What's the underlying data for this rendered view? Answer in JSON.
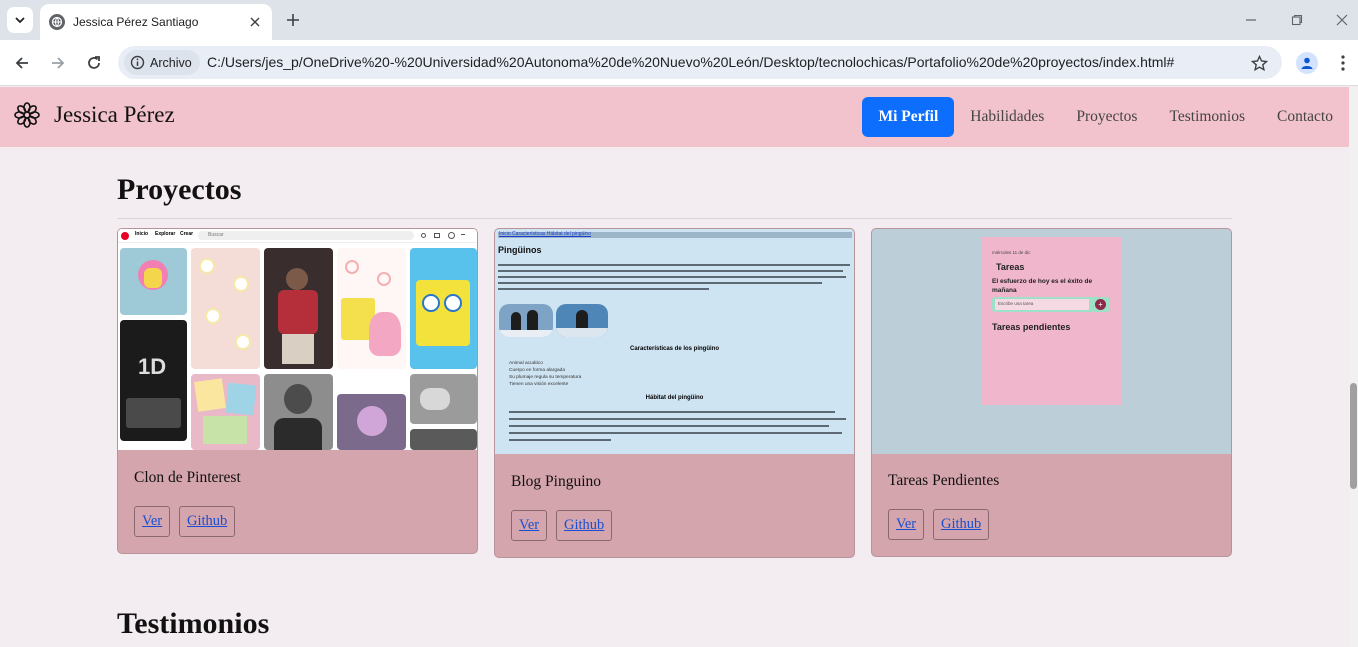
{
  "browser": {
    "tab_title": "Jessica Pérez Santiago",
    "site_chip": "Archivo",
    "url": "C:/Users/jes_p/OneDrive%20-%20Universidad%20Autonoma%20de%20Nuevo%20León/Desktop/tecnolochicas/Portafolio%20de%20proyectos/index.html#"
  },
  "header": {
    "brand": "Jessica Pérez",
    "nav": [
      {
        "label": "Mi Perfil",
        "active": true
      },
      {
        "label": "Habilidades"
      },
      {
        "label": "Proyectos"
      },
      {
        "label": "Testimonios"
      },
      {
        "label": "Contacto"
      }
    ]
  },
  "projects": {
    "title": "Proyectos",
    "cards": [
      {
        "title": "Clon de Pinterest",
        "view_label": "Ver",
        "github_label": "Github",
        "thumb": {
          "nav": [
            "Inicio",
            "Explorar",
            "Crear"
          ],
          "search": "Buscar",
          "poster_text": "1D"
        }
      },
      {
        "title": "Blog Pinguino",
        "view_label": "Ver",
        "github_label": "Github",
        "thumb": {
          "top_links": "Inicio Características Hábitat del pingüino",
          "heading": "Pingüinos",
          "section1": "Características de los pingüino",
          "list1": [
            "Animal acuático",
            "Cuerpo en forma alargada",
            "Su plumaje regula su temperatura",
            "Tienen una visión excelente"
          ],
          "section2": "Hábitat del pingüino"
        }
      },
      {
        "title": "Tareas Pendientes",
        "view_label": "Ver",
        "github_label": "Github",
        "thumb": {
          "date": "miércoles 11 de dic",
          "heading": "Tareas",
          "quote": "El esfuerzo de hoy es el éxito de mañana",
          "input_placeholder": "Escribe una tarea",
          "pending": "Tareas pendientes"
        }
      }
    ]
  },
  "testimonials": {
    "title": "Testimonios"
  }
}
